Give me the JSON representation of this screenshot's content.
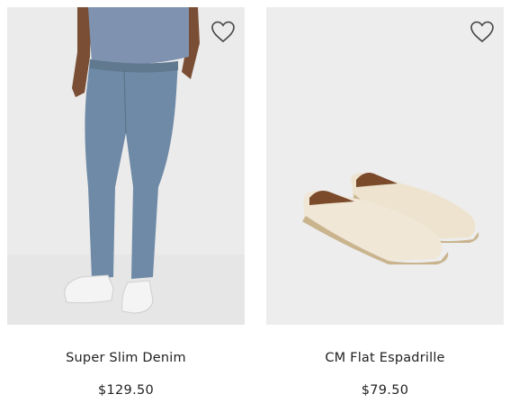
{
  "products": [
    {
      "name": "Super Slim Denim",
      "price": "$129.50",
      "favorite_icon": "heart-outline-icon"
    },
    {
      "name": "CM Flat Espadrille",
      "price": "$79.50",
      "favorite_icon": "heart-outline-icon"
    }
  ],
  "colors": {
    "image_background": "#ececec",
    "denim": "#6f8aa6",
    "shirt": "#7f93b0",
    "espadrille": "#efe6d4",
    "text": "#222222"
  }
}
